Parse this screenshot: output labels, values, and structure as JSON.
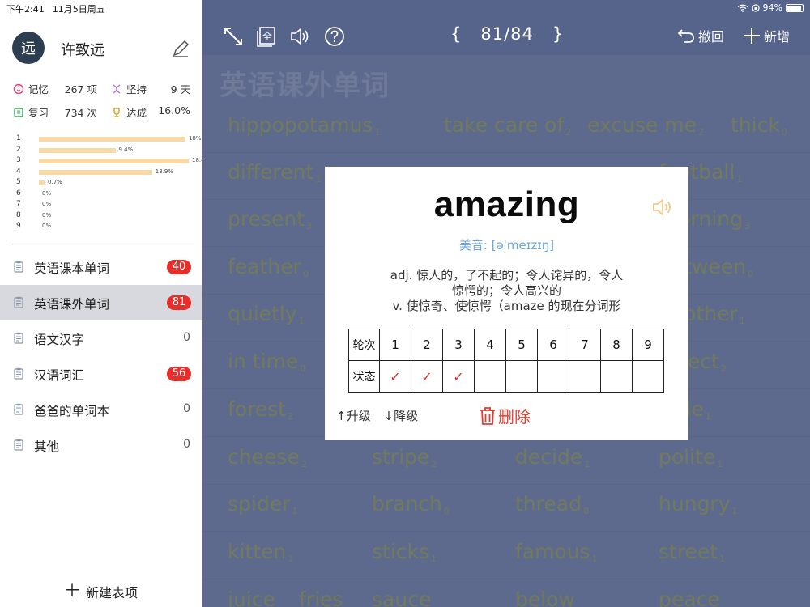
{
  "statusbar": {
    "time": "下午2:41",
    "date": "11月5日周五",
    "battery": "94%"
  },
  "profile": {
    "avatar_char": "远",
    "name": "许致远"
  },
  "stats": {
    "memory_label": "记忆",
    "memory_value": "267 项",
    "persist_label": "坚持",
    "persist_value": "9 天",
    "review_label": "复习",
    "review_value": "734 次",
    "achieve_label": "达成",
    "achieve_value": "16.0%"
  },
  "histogram": {
    "levels": [
      {
        "label": "1",
        "pct_text": "18%",
        "value": 18
      },
      {
        "label": "2",
        "pct_text": "9.4%",
        "value": 9.4
      },
      {
        "label": "3",
        "pct_text": "18.4%",
        "value": 18.4
      },
      {
        "label": "4",
        "pct_text": "13.9%",
        "value": 13.9
      },
      {
        "label": "5",
        "pct_text": "0.7%",
        "value": 0.7
      },
      {
        "label": "6",
        "pct_text": "0%",
        "value": 0
      },
      {
        "label": "7",
        "pct_text": "0%",
        "value": 0
      },
      {
        "label": "8",
        "pct_text": "0%",
        "value": 0
      },
      {
        "label": "9",
        "pct_text": "0%",
        "value": 0
      }
    ]
  },
  "lists": [
    {
      "label": "英语课本单词",
      "count": "40",
      "badge": true,
      "active": false
    },
    {
      "label": "英语课外单词",
      "count": "81",
      "badge": true,
      "active": true
    },
    {
      "label": "语文汉字",
      "count": "0",
      "badge": false,
      "active": false
    },
    {
      "label": "汉语词汇",
      "count": "56",
      "badge": true,
      "active": false
    },
    {
      "label": "爸爸的单词本",
      "count": "0",
      "badge": false,
      "active": false
    },
    {
      "label": "其他",
      "count": "0",
      "badge": false,
      "active": false
    }
  ],
  "new_table_label": "新建表项",
  "toolbar": {
    "counter": "{   81/84   }",
    "undo_label": "撤回",
    "add_label": "新增"
  },
  "board": {
    "title": "英语课外单词",
    "words": [
      {
        "text": "hippopotamus",
        "level": "1"
      },
      {
        "text": "take care of",
        "level": "2"
      },
      {
        "text": "excuse me",
        "level": "2"
      },
      {
        "text": "thick",
        "level": "0"
      },
      {
        "text": "different",
        "level": "1"
      },
      {
        "text": "football",
        "level": "1"
      },
      {
        "text": "present",
        "level": "3"
      },
      {
        "text": "morning",
        "level": "3"
      },
      {
        "text": "feather",
        "level": "0"
      },
      {
        "text": "between",
        "level": "0"
      },
      {
        "text": "quietly",
        "level": "1"
      },
      {
        "text": "another",
        "level": "1"
      },
      {
        "text": "in time",
        "level": "0"
      },
      {
        "text": "insect",
        "level": "2"
      },
      {
        "text": "forest",
        "level": "2"
      },
      {
        "text": "little",
        "level": "1"
      },
      {
        "text": "cheese",
        "level": "2"
      },
      {
        "text": "stripe",
        "level": "2"
      },
      {
        "text": "decide",
        "level": "1"
      },
      {
        "text": "polite",
        "level": "1"
      },
      {
        "text": "spider",
        "level": "1"
      },
      {
        "text": "branch",
        "level": "0"
      },
      {
        "text": "thread",
        "level": "0"
      },
      {
        "text": "hungry",
        "level": "1"
      },
      {
        "text": "kitten",
        "level": "1"
      },
      {
        "text": "sticks",
        "level": "1"
      },
      {
        "text": "famous",
        "level": "1"
      },
      {
        "text": "street",
        "level": "1"
      },
      {
        "text": "juice",
        "level": ""
      },
      {
        "text": "fries",
        "level": ""
      },
      {
        "text": "sauce",
        "level": ""
      },
      {
        "text": "below",
        "level": ""
      },
      {
        "text": "peace",
        "level": ""
      }
    ]
  },
  "card": {
    "word": "amazing",
    "phonetic": "美音: [əˈmeɪzɪŋ]",
    "def_line1": "adj. 惊人的，了不起的；令人诧异的，令人",
    "def_line2": "惊愕的；令人高兴的",
    "def_line3": "v. 使惊奇、使惊愕（amaze 的现在分词形",
    "round_label": "轮次",
    "state_label": "状态",
    "rounds": [
      "1",
      "2",
      "3",
      "4",
      "5",
      "6",
      "7",
      "8",
      "9"
    ],
    "states": [
      "✓",
      "✓",
      "✓",
      "",
      "",
      "",
      "",
      "",
      ""
    ],
    "upgrade_label": "↑升级",
    "downgrade_label": "↓降级",
    "delete_label": "删除"
  },
  "colors": {
    "accent_red": "#e62e2a",
    "phonetic_blue": "#6aa5e0",
    "bar_fill": "#f6d9a4",
    "board_bg": "#5d6a8e"
  }
}
